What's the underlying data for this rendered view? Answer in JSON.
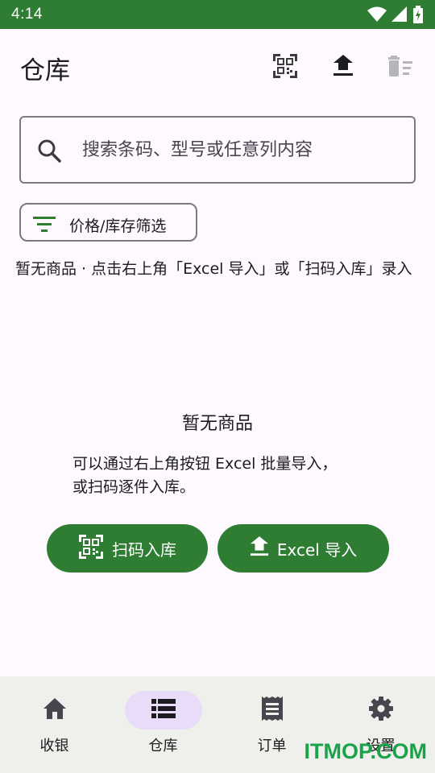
{
  "status_bar": {
    "time": "4:14",
    "icons": [
      "wifi-icon",
      "cell-signal-icon",
      "battery-charging-icon"
    ]
  },
  "app_bar": {
    "title": "仓库",
    "actions": [
      "qr-scan-icon",
      "upload-icon",
      "delete-sweep-icon"
    ]
  },
  "search": {
    "placeholder": "搜索条码、型号或任意列内容",
    "value": ""
  },
  "filter": {
    "label": "价格/库存筛选"
  },
  "hint": "暂无商品 · 点击右上角「Excel 导入」或「扫码入库」录入",
  "empty_state": {
    "title": "暂无商品",
    "description_line1": "可以通过右上角按钮 Excel 批量导入，",
    "description_line2": "或扫码逐件入库。",
    "scan_button": "扫码入库",
    "excel_button": "Excel 导入"
  },
  "bottom_nav": {
    "items": [
      {
        "label": "收银",
        "icon": "home-icon",
        "active": false
      },
      {
        "label": "仓库",
        "icon": "list-icon",
        "active": true
      },
      {
        "label": "订单",
        "icon": "receipt-icon",
        "active": false
      },
      {
        "label": "设置",
        "icon": "gear-icon",
        "active": false
      }
    ]
  },
  "watermark": "ITMOP.COM",
  "colors": {
    "primary": "#2e7d32",
    "background": "#fdf9ff",
    "nav_background": "#eff0ec",
    "nav_active_indicator": "#e8dcf8",
    "watermark": "#1aa34a"
  }
}
